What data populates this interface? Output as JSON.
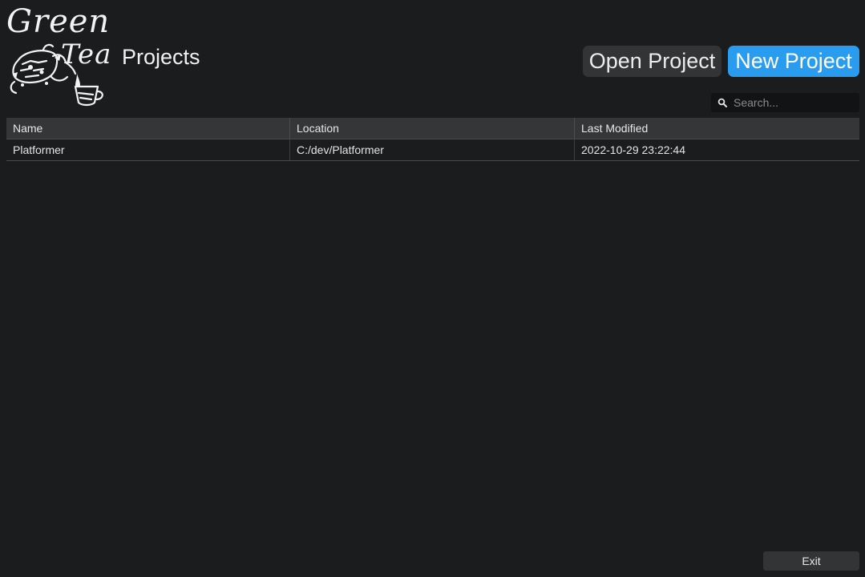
{
  "header": {
    "logo": {
      "line1": "Green",
      "line2": "Tea"
    },
    "title": "Projects",
    "open_label": "Open Project",
    "new_label": "New Project"
  },
  "search": {
    "placeholder": "Search...",
    "value": ""
  },
  "table": {
    "columns": [
      "Name",
      "Location",
      "Last Modified"
    ],
    "rows": [
      [
        "Platformer",
        "C:/dev/Platformer",
        "2022-10-29 23:22:44"
      ]
    ]
  },
  "footer": {
    "exit_label": "Exit"
  },
  "colors": {
    "background": "#1b1c1e",
    "accent": "#2a9cf0",
    "button": "#333436",
    "header_row": "#353638"
  },
  "icons": {
    "logo": "green-tea-logo-icon",
    "search": "search-icon"
  }
}
